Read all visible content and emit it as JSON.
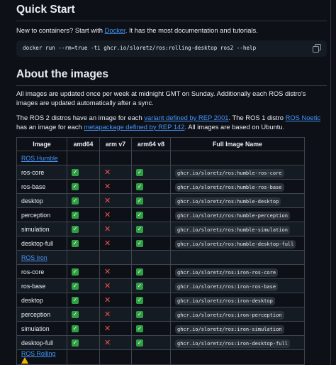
{
  "quick_start": {
    "title": "Quick Start",
    "intro_before": "New to containers? Start with ",
    "intro_link": "Docker",
    "intro_after": ". It has the most documentation and tutorials.",
    "command": "docker run --rm=true -ti ghcr.io/sloretz/ros:rolling-desktop ros2 --help"
  },
  "about": {
    "title": "About the images",
    "p1": "All images are updated once per week at midnight GMT on Sunday. Additionally each ROS distro's images are updated automatically after a sync.",
    "p2_a": "The ROS 2 distros have an image for each ",
    "p2_link1": "variant defined by REP 2001",
    "p2_b": ". The ROS 1 distro ",
    "p2_link2": "ROS Noetic",
    "p2_c": " has an image for each ",
    "p2_link3": "metapackage defined by REP 142",
    "p2_d": ". All images are based on Ubuntu."
  },
  "table": {
    "headers": [
      "Image",
      "amd64",
      "arm v7",
      "arm64 v8",
      "Full Image Name"
    ],
    "sections": [
      {
        "label": "ROS Humble",
        "rows": [
          {
            "image": "ros-core",
            "name": "ghcr.io/sloretz/ros:humble-ros-core"
          },
          {
            "image": "ros-base",
            "name": "ghcr.io/sloretz/ros:humble-ros-base"
          },
          {
            "image": "desktop",
            "name": "ghcr.io/sloretz/ros:humble-desktop"
          },
          {
            "image": "perception",
            "name": "ghcr.io/sloretz/ros:humble-perception"
          },
          {
            "image": "simulation",
            "name": "ghcr.io/sloretz/ros:humble-simulation"
          },
          {
            "image": "desktop-full",
            "name": "ghcr.io/sloretz/ros:humble-desktop-full"
          }
        ]
      },
      {
        "label": "ROS Iron",
        "rows": [
          {
            "image": "ros-core",
            "name": "ghcr.io/sloretz/ros:iron-ros-core"
          },
          {
            "image": "ros-base",
            "name": "ghcr.io/sloretz/ros:iron-ros-base"
          },
          {
            "image": "desktop",
            "name": "ghcr.io/sloretz/ros:iron-desktop"
          },
          {
            "image": "perception",
            "name": "ghcr.io/sloretz/ros:iron-perception"
          },
          {
            "image": "simulation",
            "name": "ghcr.io/sloretz/ros:iron-simulation"
          },
          {
            "image": "desktop-full",
            "name": "ghcr.io/sloretz/ros:iron-desktop-full"
          }
        ]
      },
      {
        "label": "ROS Rolling",
        "warning_icon": "warning-icon",
        "rows": []
      }
    ],
    "support": {
      "amd64": "yes",
      "arm_v7": "no",
      "arm64_v8": "yes"
    }
  },
  "colors": {
    "background": "#0d1117",
    "link": "#4493f8",
    "check": "#2ea043",
    "cross": "#f85149",
    "warning": "#f0b400"
  }
}
